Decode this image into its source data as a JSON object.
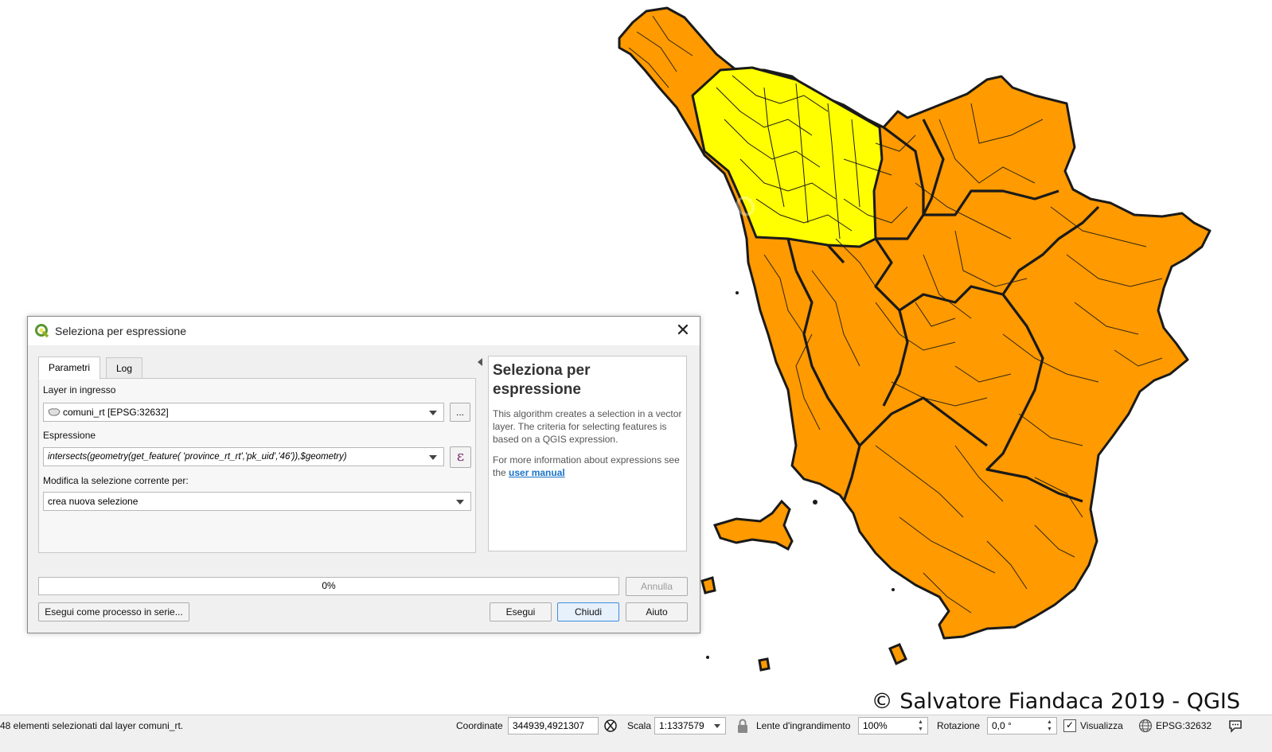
{
  "map": {
    "copyright": "© Salvatore Fiandaca 2019 - QGIS",
    "watermark": "Pierpaolo in infinito",
    "colors": {
      "selected": "#ffff00",
      "unselected": "#ff9a00",
      "border": "#1a1a1a"
    }
  },
  "dialog": {
    "title": "Seleziona per espressione",
    "tabs": [
      "Parametri",
      "Log"
    ],
    "active_tab": "Parametri",
    "input_layer_label": "Layer in ingresso",
    "input_layer_value": "comuni_rt [EPSG:32632]",
    "browse_label": "...",
    "expression_label": "Espressione",
    "expression_value": "intersects(geometry(get_feature( 'province_rt_rt','pk_uid','46')),$geometry)",
    "epsilon_symbol": "ε",
    "modify_label": "Modifica la selezione corrente per:",
    "modify_value": "crea nuova selezione",
    "help": {
      "title": "Seleziona per espressione",
      "description": "This algorithm creates a selection in a vector layer. The criteria for selecting features is based on a QGIS expression.",
      "more_info_prefix": "For more information about expressions see the",
      "link_text": "user manual"
    },
    "progress_text": "0%",
    "progress_value": 0,
    "buttons": {
      "cancel": "Annulla",
      "batch": "Esegui come processo in serie...",
      "run": "Esegui",
      "close": "Chiudi",
      "help": "Aiuto"
    }
  },
  "statusbar": {
    "message": "48 elementi selezionati dal layer comuni_rt.",
    "coordinate_label": "Coordinate",
    "coordinate_value": "344939,4921307",
    "scale_label": "Scala",
    "scale_value": "1:1337579",
    "magnifier_label": "Lente d'ingrandimento",
    "magnifier_value": "100%",
    "rotation_label": "Rotazione",
    "rotation_value": "0,0 °",
    "render_label": "Visualizza",
    "render_checked": true,
    "crs_label": "EPSG:32632"
  }
}
